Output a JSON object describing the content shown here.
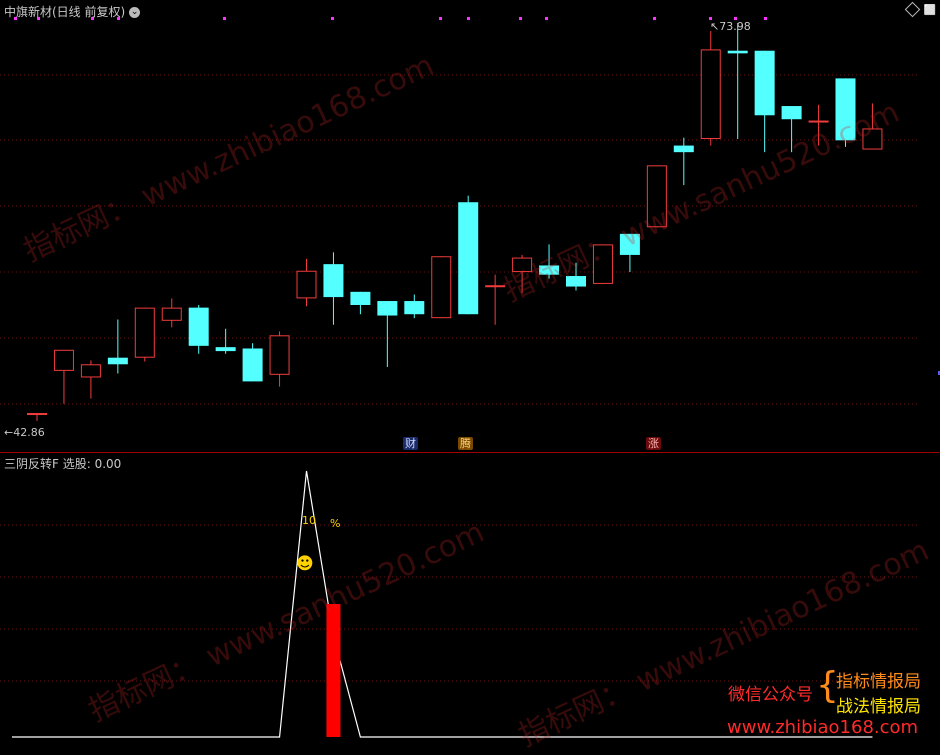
{
  "main_panel": {
    "title": "中旗新材(日线 前复权)",
    "max_label": "73.98",
    "min_label": "42.86",
    "candles": [
      {
        "o": 44.3,
        "h": 44.3,
        "l": 43.7,
        "c": 44.3
      },
      {
        "o": 47.5,
        "h": 47.5,
        "l": 45.0,
        "c": 49.1
      },
      {
        "o": 47.0,
        "h": 48.3,
        "l": 45.4,
        "c": 48.0
      },
      {
        "o": 48.5,
        "h": 51.4,
        "l": 47.3,
        "c": 48.0
      },
      {
        "o": 48.5,
        "h": 52.3,
        "l": 48.2,
        "c": 52.3
      },
      {
        "o": 51.3,
        "h": 53.0,
        "l": 50.8,
        "c": 52.3
      },
      {
        "o": 52.3,
        "h": 52.5,
        "l": 48.8,
        "c": 49.4
      },
      {
        "o": 49.3,
        "h": 50.7,
        "l": 48.8,
        "c": 49.0
      },
      {
        "o": 49.2,
        "h": 49.6,
        "l": 46.7,
        "c": 46.7
      },
      {
        "o": 47.2,
        "h": 50.5,
        "l": 46.3,
        "c": 50.2
      },
      {
        "o": 53.0,
        "h": 56.0,
        "l": 52.4,
        "c": 55.1
      },
      {
        "o": 55.6,
        "h": 56.5,
        "l": 51.0,
        "c": 53.1
      },
      {
        "o": 53.5,
        "h": 53.5,
        "l": 51.8,
        "c": 52.5
      },
      {
        "o": 52.8,
        "h": 52.8,
        "l": 47.8,
        "c": 51.7
      },
      {
        "o": 52.8,
        "h": 53.3,
        "l": 51.5,
        "c": 51.8
      },
      {
        "o": 51.5,
        "h": 56.2,
        "l": 51.5,
        "c": 56.2
      },
      {
        "o": 60.3,
        "h": 60.8,
        "l": 51.8,
        "c": 51.8
      },
      {
        "o": 54.0,
        "h": 54.8,
        "l": 51.0,
        "c": 54.0
      },
      {
        "o": 55.0,
        "h": 56.3,
        "l": 53.4,
        "c": 56.1
      },
      {
        "o": 55.5,
        "h": 57.1,
        "l": 54.5,
        "c": 54.8
      },
      {
        "o": 54.7,
        "h": 55.7,
        "l": 53.6,
        "c": 53.9
      },
      {
        "o": 54.1,
        "h": 57.1,
        "l": 54.1,
        "c": 57.1
      },
      {
        "o": 57.9,
        "h": 57.9,
        "l": 55.0,
        "c": 56.3
      },
      {
        "o": 58.4,
        "h": 63.1,
        "l": 58.4,
        "c": 63.1
      },
      {
        "o": 64.6,
        "h": 65.2,
        "l": 61.6,
        "c": 64.1
      },
      {
        "o": 65.1,
        "h": 73.3,
        "l": 64.6,
        "c": 71.9
      },
      {
        "o": 71.8,
        "h": 73.9,
        "l": 65.1,
        "c": 71.6
      },
      {
        "o": 71.8,
        "h": 71.8,
        "l": 64.1,
        "c": 66.9
      },
      {
        "o": 67.6,
        "h": 67.6,
        "l": 64.1,
        "c": 66.6
      },
      {
        "o": 66.5,
        "h": 67.7,
        "l": 64.6,
        "c": 66.5
      },
      {
        "o": 69.7,
        "h": 69.7,
        "l": 64.5,
        "c": 65.0
      },
      {
        "o": 64.3,
        "h": 67.8,
        "l": 64.3,
        "c": 65.9
      }
    ],
    "event_markers": [
      {
        "label": "财",
        "bg": "#1a2b6a",
        "fg": "#d0d8ff"
      },
      {
        "label": "腾",
        "bg": "#7a4a00",
        "fg": "#ffd27a"
      },
      {
        "label": "涨",
        "bg": "#6a0a0a",
        "fg": "#ffb0b0"
      }
    ]
  },
  "sub_panel": {
    "title": "三阴反转F 选股: 0.00",
    "line_values": [
      0,
      0,
      0,
      0,
      0,
      0,
      0,
      0,
      0,
      0,
      100,
      38,
      0,
      0,
      0,
      0,
      0,
      0,
      0,
      0,
      0,
      0,
      0,
      0,
      0,
      0,
      0,
      0,
      0,
      0,
      0,
      0
    ],
    "bar_value": 50,
    "bar_index": 11,
    "annotation_number": "10",
    "annotation_percent": "%",
    "smiley": "☻"
  },
  "watermarks": [
    "www.zhibiao168.com",
    "指标网",
    "www.sanhu520.com"
  ],
  "promo": {
    "wechat_label": "微信公众号",
    "brace": "{",
    "line1": "指标情报局",
    "line2": "战法情报局",
    "url": "www.zhibiao168.com"
  },
  "colors": {
    "up": "#f03c3c",
    "down": "#54ffff",
    "grid": "#6e1010",
    "dots": "#ff33ff",
    "label_yellow": "#ffd200",
    "bar_red": "#ff0000",
    "promo_red": "#ff2a2a",
    "promo_orange": "#ff8c1a",
    "promo_yellow": "#ffe600"
  }
}
